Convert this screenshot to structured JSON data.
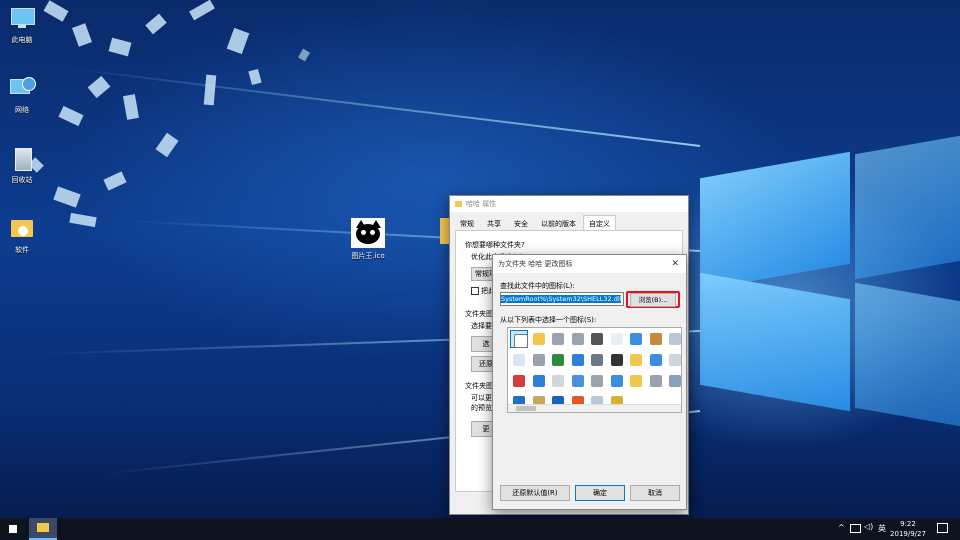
{
  "desktop": {
    "icons": [
      {
        "label": "此电脑",
        "icon": "computer-icon"
      },
      {
        "label": "网络",
        "icon": "network-icon"
      },
      {
        "label": "回收站",
        "icon": "recycle-bin-icon"
      },
      {
        "label": "软件",
        "icon": "folder-icon"
      },
      {
        "label": "图片王.ico",
        "icon": "cat-image-icon"
      }
    ]
  },
  "properties": {
    "title": "哈哈 属性",
    "tabs": [
      "常规",
      "共享",
      "安全",
      "以前的版本",
      "自定义"
    ],
    "active_tab": "自定义",
    "question": "你想要哪种文件夹?",
    "optimize_label": "优化此文件夹(T):",
    "optimize_value": "常规项",
    "apply_sub": "把此",
    "folder_pic_heading": "文件夹图",
    "folder_pic_choose": "选择要在",
    "btn1": "选",
    "btn2": "还原",
    "folder_icon_heading": "文件夹图",
    "folder_icon_desc1": "可以更改",
    "folder_icon_desc2": "的预览。",
    "btn3": "更"
  },
  "change_icon": {
    "title": "为文件夹 哈哈 更改图标",
    "find_label": "查找此文件中的图标(L):",
    "path_value": "SystemRoot%\\System32\\SHELL32.dll",
    "browse_label": "浏览(B)...",
    "list_label": "从以下列表中选择一个图标(S):",
    "restore_label": "还原默认值(R)",
    "ok_label": "确定",
    "cancel_label": "取消",
    "icons": [
      "blank-doc-icon",
      "folder-icon",
      "drive-icon",
      "drive-icon",
      "printer-icon",
      "document-icon",
      "window-icon",
      "arrow-icon",
      "recycle-bin-icon",
      "chart-doc-icon",
      "drive-icon",
      "globe-icon",
      "network-icon",
      "settings-icon",
      "shortcut-icon",
      "folder-icon",
      "window-icon",
      "cd-icon",
      "delete-drive-icon",
      "network-icon",
      "cd-icon",
      "search-icon",
      "drive-icon",
      "window-icon",
      "folder-icon",
      "drive-icon",
      "clock-icon",
      "monitor-icon",
      "grid-icon",
      "help-icon",
      "power-icon",
      "recycle-bin-icon",
      "trophy-icon"
    ]
  },
  "taskbar": {
    "lang": "英",
    "time": "9:22",
    "date": "2019/9/27"
  },
  "colors": {
    "accent": "#0078d7",
    "highlight": "#e81123"
  }
}
